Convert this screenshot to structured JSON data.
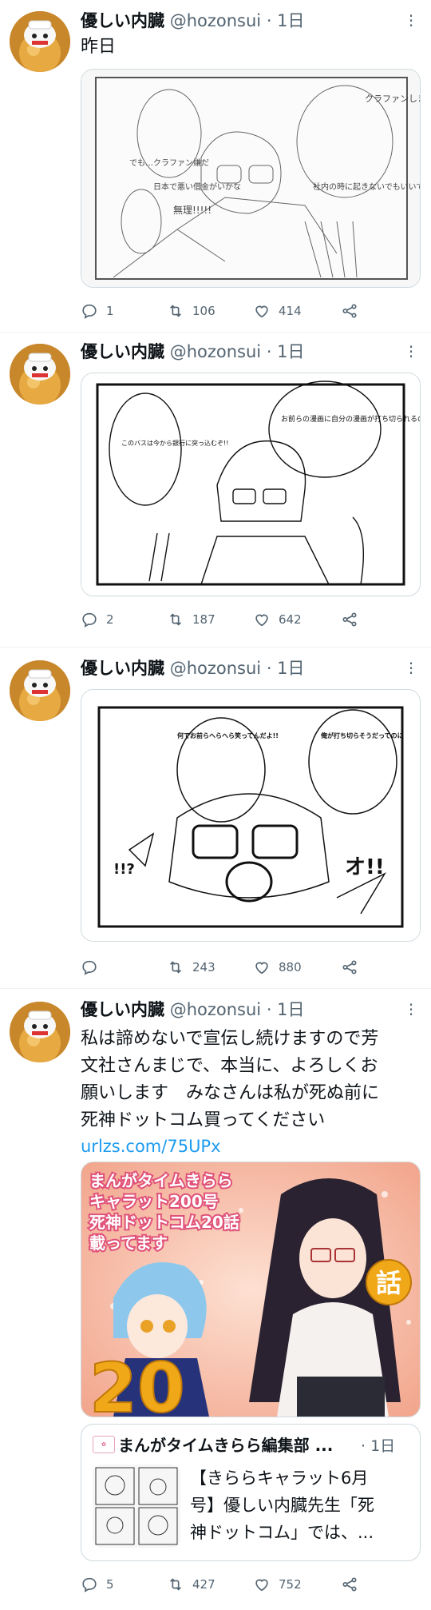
{
  "tweets": [
    {
      "name": "優しい内臓",
      "handle": "@hozonsui",
      "time": "· 1日",
      "text": "昨日",
      "replies": "1",
      "retweets": "106",
      "likes": "414",
      "image_text": [
        "クラファンしましょうよ!!",
        "社内の時に起きないでもいいです",
        "でも…クラファン嫌だ",
        "日本で悪い借金がいかな",
        "無理!!!!!"
      ]
    },
    {
      "name": "優しい内臓",
      "handle": "@hozonsui",
      "time": "· 1日",
      "text": "",
      "replies": "2",
      "retweets": "187",
      "likes": "642",
      "image_text": [
        "お前らの漫画に自分の漫画が打ち切られるのかチェックがかかるか…?",
        "このバスは今から銀行に突っ込むぞ!!"
      ]
    },
    {
      "name": "優しい内臓",
      "handle": "@hozonsui",
      "time": "· 1日",
      "text": "",
      "replies": "",
      "retweets": "243",
      "likes": "880",
      "image_text": [
        "俺が打ち切らそうだってのに",
        "何でお前らへらへら笑ってんだよ!!",
        "!!?",
        "オ!!"
      ]
    },
    {
      "name": "優しい内臓",
      "handle": "@hozonsui",
      "time": "· 1日",
      "text_lines": [
        "私は諦めないで宣伝し続けますので芳",
        "文社さんまじで、本当に、よろしくお",
        "願いします　みなさんは私が死ぬ前に",
        "死神ドットコム買ってください"
      ],
      "link": "urlzs.com/75UPx",
      "banner_lines": [
        "まんがタイムきらら",
        "キャラット200号",
        "死神ドットコム20話",
        "載ってます"
      ],
      "banner_number": "20",
      "banner_char": "話",
      "quote_name": "まんがタイムきらら編集部 ...",
      "quote_time": "· 1日",
      "quote_text_lines": [
        "【きららキャラット6月",
        "号】優しい内臓先生「死",
        "神ドットコム」では、..."
      ],
      "replies": "5",
      "retweets": "427",
      "likes": "752"
    }
  ],
  "colors": {
    "muted": "#536471",
    "link": "#1d9bf0",
    "border": "#cfd9de",
    "banner_bg": "#f6b39e"
  }
}
